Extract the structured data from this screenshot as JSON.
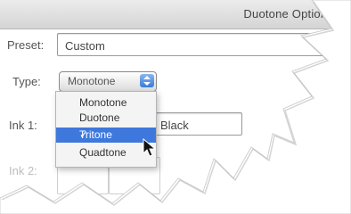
{
  "window": {
    "title": "Duotone Options"
  },
  "preset": {
    "label": "Preset:",
    "value": "Custom"
  },
  "type": {
    "label": "Type:",
    "selected": "Monotone",
    "options": [
      "Monotone",
      "Duotone",
      "Tritone",
      "Quadtone"
    ],
    "highlighted": "Tritone"
  },
  "inks": [
    {
      "label": "Ink 1:",
      "name": "Black"
    },
    {
      "label": "Ink 2:"
    }
  ],
  "colors": {
    "highlight": "#3f78dd",
    "page": "#ffffff"
  }
}
